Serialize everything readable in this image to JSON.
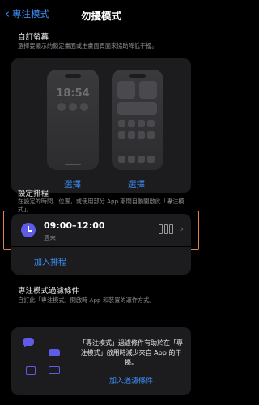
{
  "nav": {
    "back_label": "專注模式",
    "title": "勿擾模式"
  },
  "customize_screens": {
    "title": "自訂螢幕",
    "description": "選擇要顯示的鎖定畫面或主畫面頁面來協助降低干擾。",
    "lock_time": "18:54",
    "pick_label_left": "選擇",
    "pick_label_right": "選擇"
  },
  "schedule": {
    "title": "設定排程",
    "description": "在設定的時間、位置，或使用部分 App 期間自動開啟此「專注模式」。",
    "item_time": "09:00–12:00",
    "item_days": "週末",
    "add_label": "加入排程"
  },
  "filters": {
    "title": "專注模式過濾條件",
    "description": "自訂此「專注模式」開啟時 App 和裝置的運作方式。",
    "card_text": "「專注模式」過濾條件有助於在「專注模式」啟用時減少來自 App 的干擾。",
    "add_label": "加入過濾條件"
  },
  "colors": {
    "accent": "#3c8ef8",
    "highlight_border": "#e2824a",
    "schedule_icon": "#5e5ce6"
  },
  "icons": [
    "chevron-left-icon",
    "clock-icon",
    "calendar-icon",
    "chevron-right-icon",
    "chat-bubble-icon",
    "game-controller-icon",
    "calendar-small-icon",
    "credit-card-icon"
  ]
}
